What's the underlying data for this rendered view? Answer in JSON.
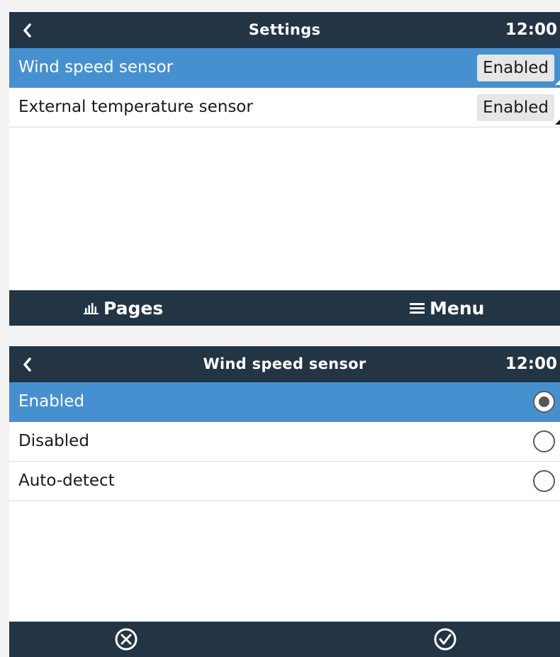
{
  "settings_screen": {
    "title": "Settings",
    "clock": "12:00",
    "rows": [
      {
        "label": "Wind speed sensor",
        "value": "Enabled"
      },
      {
        "label": "External temperature sensor",
        "value": "Enabled"
      }
    ],
    "footer": {
      "pages_label": "Pages",
      "menu_label": "Menu"
    }
  },
  "wind_screen": {
    "title": "Wind speed sensor",
    "clock": "12:00",
    "options": [
      {
        "label": "Enabled"
      },
      {
        "label": "Disabled"
      },
      {
        "label": "Auto-detect"
      }
    ],
    "selected_option": "Enabled"
  },
  "colors": {
    "header_bg": "#233444",
    "selection": "#4790d0",
    "value_bg": "#e6e6e6"
  },
  "icons": {
    "back": "chevron-left-icon",
    "pages": "bar-chart-icon",
    "menu": "hamburger-icon",
    "cancel": "circle-x-icon",
    "confirm": "circle-check-icon"
  }
}
